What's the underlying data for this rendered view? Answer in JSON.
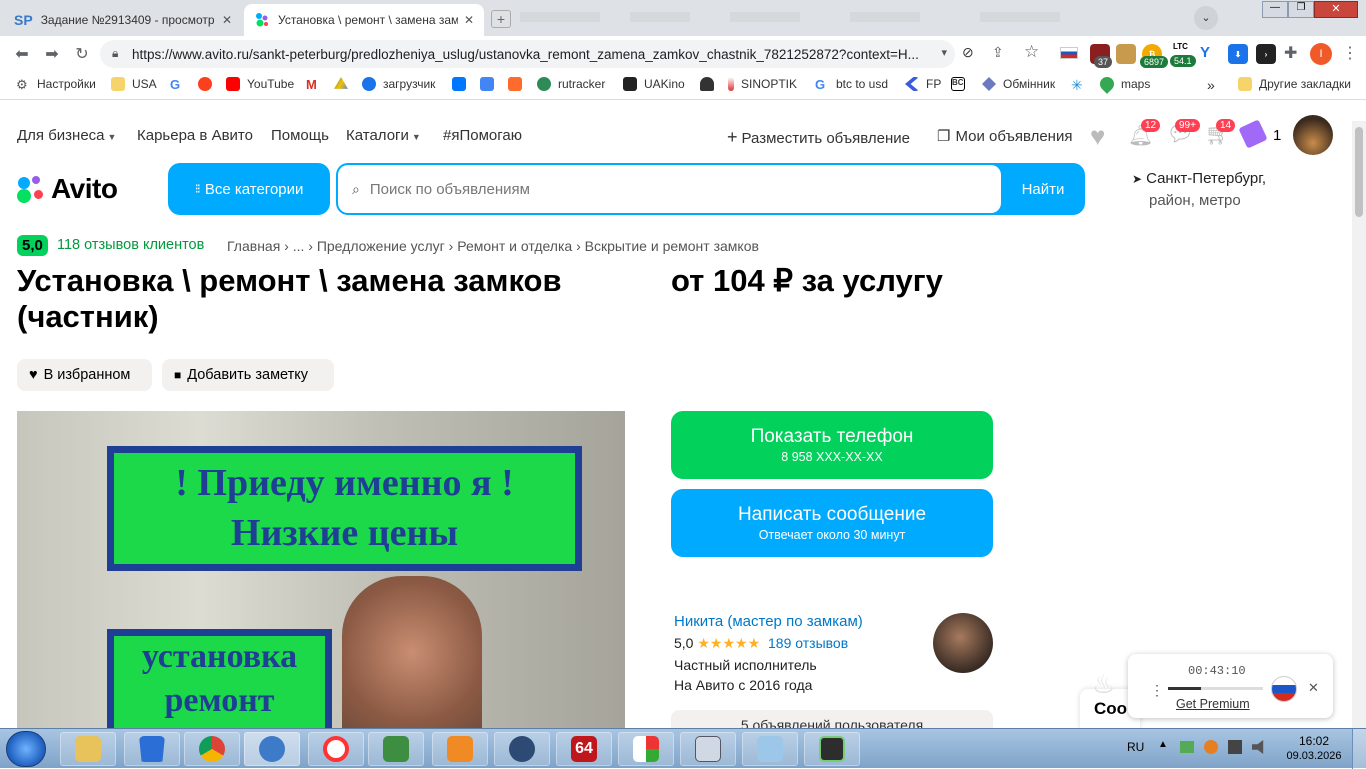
{
  "browser": {
    "tabs": [
      {
        "label": "Задание №2913409 - просмотр з",
        "favicon": "SP"
      },
      {
        "label": "Установка \\ ремонт \\ замена зам",
        "favicon": "avito"
      }
    ],
    "url": "https://www.avito.ru/sankt-peterburg/predlozheniya_uslug/ustanovka_remont_zamena_zamkov_chastnik_7821252872?context=H...",
    "ext_badges": {
      "b1": "37",
      "b2": "6897",
      "ltc_label": "LTC",
      "ltc_value": "54.1"
    },
    "profile_initial": "I",
    "bookmarks": [
      "Настройки",
      "USA",
      "YouTube",
      "загрузчик",
      "rutracker",
      "UAKino",
      "SINOPTIK",
      "btc to usd",
      "FP",
      "Обмінник",
      "maps"
    ],
    "bookmarks_more": "»",
    "other_bookmarks": "Другие закладки"
  },
  "nav": {
    "business": "Для бизнеса",
    "career": "Карьера в Авито",
    "help": "Помощь",
    "catalogs": "Каталоги",
    "help_tag": "#яПомогаю",
    "post_ad": "Разместить объявление",
    "my_ads": "Мои объявления",
    "notif_count": "12",
    "msg_count": "99+",
    "cart_count": "14",
    "ticket_count": "1"
  },
  "header": {
    "logo": "Avito",
    "all_categories": "Все категории",
    "search_placeholder": "Поиск по объявлениям",
    "find_button": "Найти",
    "city": "Санкт-Петербург,",
    "district": "район, метро"
  },
  "listing": {
    "rating": "5,0",
    "reviews_link": "118 отзывов клиентов",
    "breadcrumbs": "Главная › ... › Предложение услуг › Ремонт и отделка › Вскрытие и ремонт замков",
    "title": "Установка \\ ремонт \\ замена замков (частник)",
    "price": "от 104 ₽ за услугу",
    "favorite_chip": "В избранном",
    "note_chip": "Добавить заметку",
    "photo_text1": "! Приеду именно я !",
    "photo_text2": "Низкие цены",
    "photo_text3": "установка",
    "photo_text4": "ремонт"
  },
  "actions": {
    "show_phone": "Показать телефон",
    "phone_masked": "8 958 XXX-XX-XX",
    "write_message": "Написать сообщение",
    "reply_time": "Отвечает около 30 минут"
  },
  "seller": {
    "name": "Никита (мастер по замкам)",
    "rating": "5,0",
    "stars": "★★★★★",
    "reviews": "189 отзывов",
    "type": "Частный исполнитель",
    "since": "На Авито с 2016 года",
    "ads_count": "5 объявлений пользователя"
  },
  "player": {
    "time": "00:43:10",
    "premium": "Get Premium",
    "partial_text": "Соо",
    "progress_fraction": 0.35
  },
  "taskbar": {
    "lang": "RU",
    "time": "16:02",
    "date": "09.03.2026"
  },
  "colors": {
    "avito_blue": "#00aaff",
    "avito_green": "#02d15c",
    "badge_red": "#ff4053",
    "link_blue": "#0078c8"
  }
}
